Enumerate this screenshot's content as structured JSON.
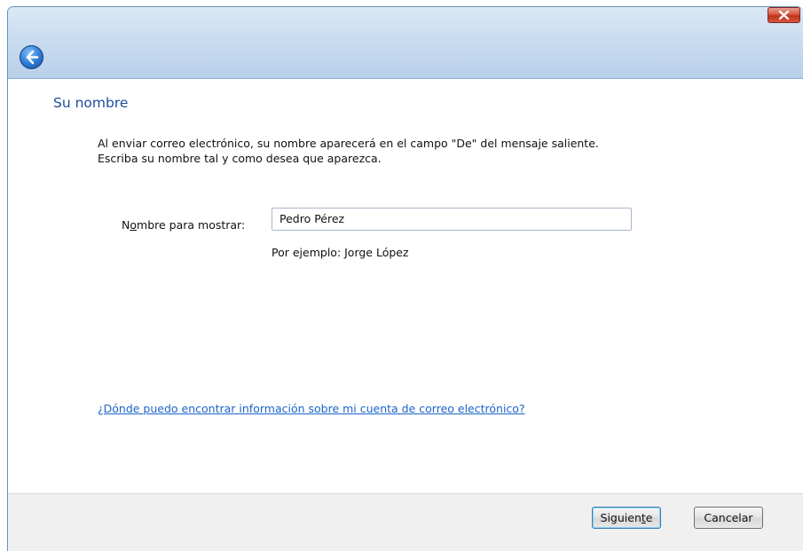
{
  "window": {
    "close_glyph": "×",
    "back_icon": "back-arrow-icon"
  },
  "page": {
    "title": "Su nombre",
    "description_line1": "Al enviar correo electrónico, su nombre aparecerá en el campo \"De\" del mensaje saliente.",
    "description_line2": "Escriba su nombre tal y como desea que aparezca."
  },
  "form": {
    "label_prefix": "N",
    "label_mnemonic": "o",
    "label_suffix": "mbre para mostrar:",
    "value": "Pedro Pérez",
    "example": "Por ejemplo: Jorge López"
  },
  "help": {
    "link_text": "¿Dónde puedo encontrar información sobre mi cuenta de correo electrónico?"
  },
  "buttons": {
    "next_prefix": "Siguien",
    "next_mnemonic": "t",
    "next_suffix": "e",
    "cancel": "Cancelar"
  },
  "colors": {
    "title_blue": "#1e4b9a",
    "link_blue": "#1a64c9",
    "close_red": "#c2311b"
  }
}
